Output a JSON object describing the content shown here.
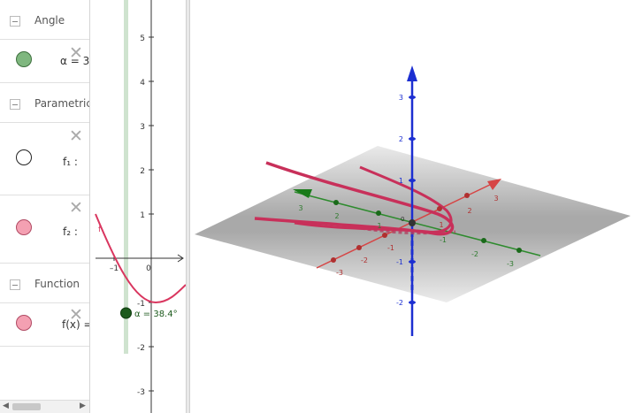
{
  "algebra": {
    "headers": {
      "angle": "Angle",
      "parametric": "Parametric",
      "function": "Function"
    },
    "rows": {
      "alpha": {
        "text": "α = 3",
        "color": "#7fb77f"
      },
      "f1": {
        "text": "f₁ :",
        "color": "#ffffff"
      },
      "f2": {
        "text": "f₂ :",
        "color": "#f4a0b2"
      },
      "f": {
        "text": "f(x) =",
        "color": "#f4a0b2"
      }
    },
    "close_glyph": "✕"
  },
  "view2d": {
    "y_ticks": [
      "5",
      "4",
      "3",
      "2",
      "1",
      "-1",
      "-2",
      "-3"
    ],
    "x_ticks": [
      "–1",
      "0"
    ],
    "func_label": "f",
    "slider_label": "α = 38.4°",
    "slider_value_deg": 38.4
  },
  "view3d": {
    "z_ticks": [
      "3",
      "2",
      "1",
      "-1",
      "-2"
    ],
    "x_ticks": [
      "3",
      "2",
      "1",
      "-1",
      "-2",
      "-3"
    ],
    "y_ticks": [
      "3",
      "2",
      "1",
      "-1",
      "-2",
      "-3"
    ],
    "origin_label": "0",
    "colors": {
      "x_axis": "#d64545",
      "y_axis": "#2e8b2e",
      "z_axis": "#1c2fd1",
      "curve": "#c8305a"
    }
  }
}
